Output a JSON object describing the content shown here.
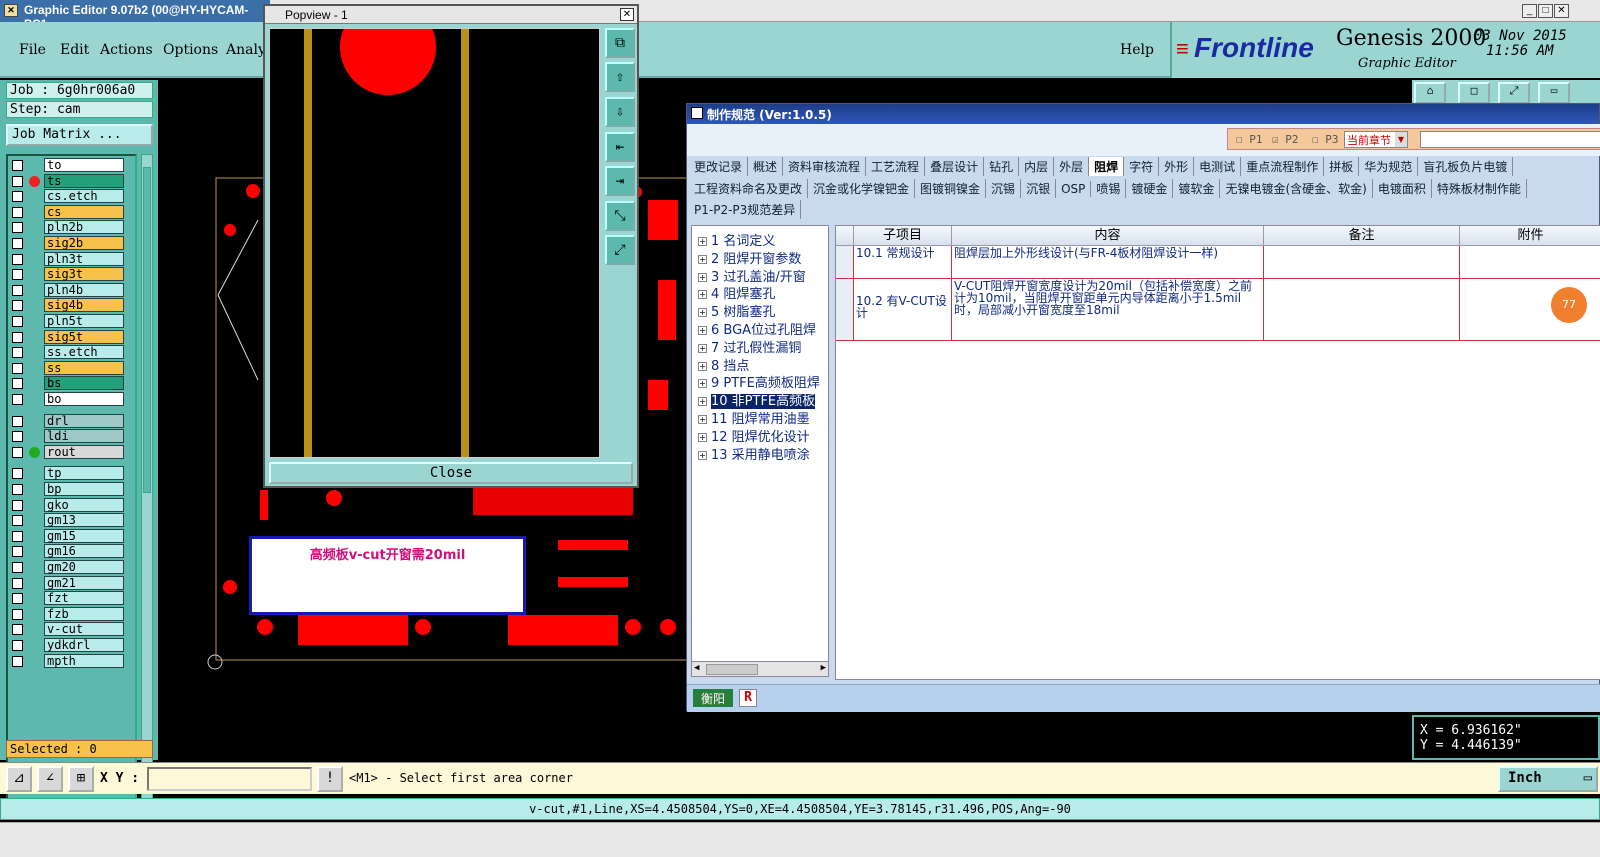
{
  "app": {
    "title": "Graphic Editor 9.07b2 (00@HY-HYCAM-PC1"
  },
  "menu": {
    "file": "File",
    "edit": "Edit",
    "actions": "Actions",
    "options": "Options",
    "analysis": "Analy",
    "help": "Help"
  },
  "brand": {
    "logo": "Frontline",
    "product": "Genesis 2000",
    "subtitle": "Graphic Editor",
    "date": "03 Nov 2015",
    "time": "11:56 AM"
  },
  "job": {
    "job_label": "Job : 6g0hr006a0",
    "step_label": "Step: cam",
    "matrix_label": "Job Matrix ..."
  },
  "layers": [
    {
      "name": "to",
      "color": "#ffffff",
      "dot": false
    },
    {
      "name": "ts",
      "color": "#24a07a",
      "dot": true
    },
    {
      "name": "cs.etch",
      "color": "#b8ecea",
      "dot": false
    },
    {
      "name": "cs",
      "color": "#f7c24a",
      "dot": false
    },
    {
      "name": "pln2b",
      "color": "#b8ecea",
      "dot": false
    },
    {
      "name": "sig2b",
      "color": "#f7c24a",
      "dot": false
    },
    {
      "name": "pln3t",
      "color": "#b8ecea",
      "dot": false
    },
    {
      "name": "sig3t",
      "color": "#f7c24a",
      "dot": false
    },
    {
      "name": "pln4b",
      "color": "#b8ecea",
      "dot": false
    },
    {
      "name": "sig4b",
      "color": "#f7c24a",
      "dot": false
    },
    {
      "name": "pln5t",
      "color": "#b8ecea",
      "dot": false
    },
    {
      "name": "sig5t",
      "color": "#f7c24a",
      "dot": false
    },
    {
      "name": "ss.etch",
      "color": "#b8ecea",
      "dot": false
    },
    {
      "name": "ss",
      "color": "#f7c24a",
      "dot": false
    },
    {
      "name": "bs",
      "color": "#24a07a",
      "dot": false
    },
    {
      "name": "bo",
      "color": "#ffffff",
      "dot": false
    },
    {
      "name": "drl",
      "color": "#9fc8c8",
      "dot": false
    },
    {
      "name": "ldi",
      "color": "#9fc8c8",
      "dot": false
    },
    {
      "name": "rout",
      "color": "#d8d8d8",
      "dot": true
    },
    {
      "name": "tp",
      "color": "#b8ecea",
      "dot": false
    },
    {
      "name": "bp",
      "color": "#b8ecea",
      "dot": false
    },
    {
      "name": "gko",
      "color": "#b8ecea",
      "dot": false
    },
    {
      "name": "gm13",
      "color": "#b8ecea",
      "dot": false
    },
    {
      "name": "gm15",
      "color": "#b8ecea",
      "dot": false
    },
    {
      "name": "gm16",
      "color": "#b8ecea",
      "dot": false
    },
    {
      "name": "gm20",
      "color": "#b8ecea",
      "dot": false
    },
    {
      "name": "gm21",
      "color": "#b8ecea",
      "dot": false
    },
    {
      "name": "fzt",
      "color": "#b8ecea",
      "dot": false
    },
    {
      "name": "fzb",
      "color": "#b8ecea",
      "dot": false
    },
    {
      "name": "v-cut",
      "color": "#b8ecea",
      "dot": false
    },
    {
      "name": "ydkdrl",
      "color": "#b8ecea",
      "dot": false
    },
    {
      "name": "mpth",
      "color": "#b8ecea",
      "dot": false
    }
  ],
  "selected": "Selected : 0",
  "popview": {
    "title": "Popview - 1",
    "close": "Close"
  },
  "note": "高频板v-cut开窗需20mil",
  "spec": {
    "title": "制作规范 (Ver:1.0.5)",
    "p1": "P1",
    "p2": "P2",
    "p3": "P3",
    "chapter": "当前章节",
    "tabs1": [
      "更改记录",
      "概述",
      "资料审核流程",
      "工艺流程",
      "叠层设计",
      "钻孔",
      "内层",
      "外层",
      "阻焊",
      "字符",
      "外形",
      "电测试",
      "重点流程制作",
      "拼板",
      "华为规范",
      "盲孔板负片电镀"
    ],
    "tabs2": [
      "工程资料命名及更改",
      "沉金或化学镍钯金",
      "图镀铜镍金",
      "沉锡",
      "沉银",
      "OSP",
      "喷锡",
      "镀硬金",
      "镀软金",
      "无镍电镀金(含硬金、软金)",
      "电镀面积",
      "特殊板材制作能"
    ],
    "tabs3": [
      "P1-P2-P3规范差异"
    ],
    "tree": [
      "1 名词定义",
      "2 阻焊开窗参数",
      "3 过孔盖油/开窗",
      "4 阻焊塞孔",
      "5 树脂塞孔",
      "6 BGA位过孔阻焊",
      "7 过孔假性漏铜",
      "8 挡点",
      "9 PTFE高频板阻焊",
      "10 非PTFE高频板",
      "11 阻焊常用油墨",
      "12 阻焊优化设计",
      "13 采用静电喷涂"
    ],
    "headers": [
      "子项目",
      "内容",
      "备注",
      "附件"
    ],
    "rows": [
      {
        "item": "10.1 常规设计",
        "content": "阻焊层加上外形线设计(与FR-4板材阻焊设计一样)"
      },
      {
        "item": "10.2 有V-CUT设计",
        "content": "V-CUT阻焊开窗宽度设计为20mil（包括补偿宽度）之前计为10mil，当阻焊开窗距单元内导体距离小于1.5mil时，局部减小开窗宽度至18mil"
      }
    ],
    "footer_tag": "衡阳",
    "footer_r": "R",
    "badge": "77"
  },
  "coords": {
    "x": "X = 6.936162\"",
    "y": "Y = 4.446139\""
  },
  "cmd": {
    "xy_label": "X Y :",
    "xy_value": "",
    "prompt": "<M1> - Select first area corner",
    "unit": "Inch"
  },
  "status": "v-cut,#1,Line,XS=4.4508504,YS=0,XE=4.4508504,YE=3.78145,r31.496,POS,Ang=-90"
}
